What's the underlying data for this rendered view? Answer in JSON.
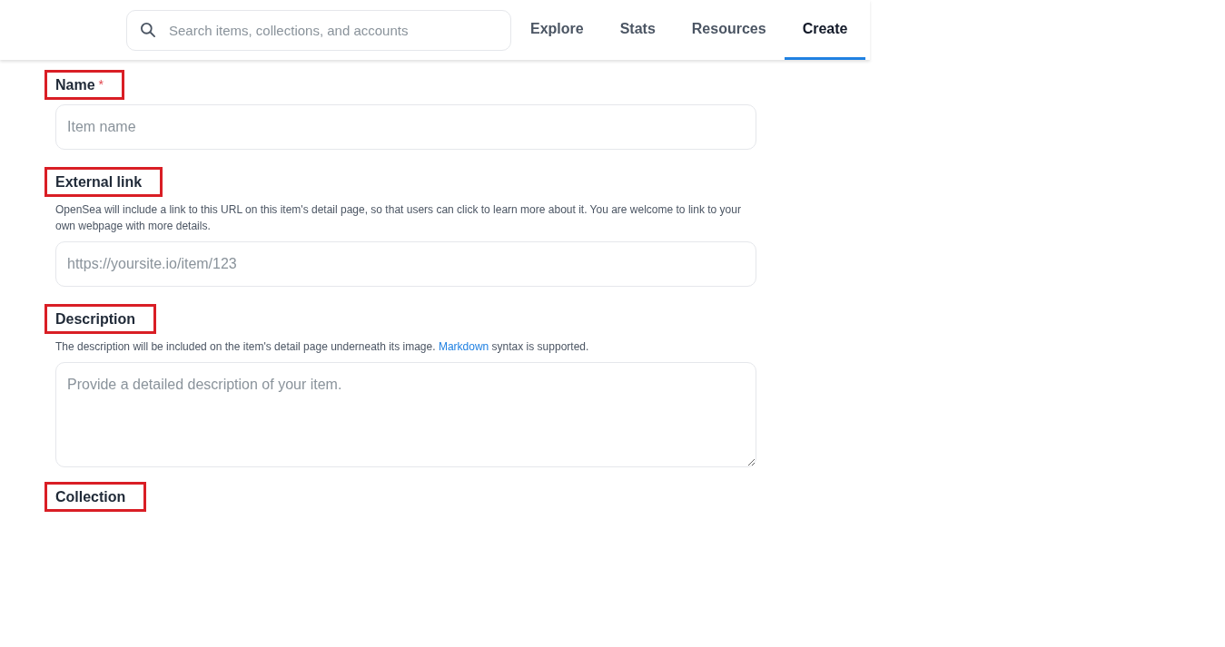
{
  "header": {
    "search": {
      "placeholder": "Search items, collections, and accounts"
    },
    "nav": [
      {
        "label": "Explore",
        "selected": false
      },
      {
        "label": "Stats",
        "selected": false
      },
      {
        "label": "Resources",
        "selected": false
      },
      {
        "label": "Create",
        "selected": true
      }
    ]
  },
  "form": {
    "fields": [
      {
        "kind": "input",
        "label": "Name",
        "required_mark": "*",
        "highlighted": true,
        "placeholder": "Item name"
      },
      {
        "kind": "input",
        "label": "External link",
        "highlighted": true,
        "hint": {
          "text": "OpenSea will include a link to this URL on this item's detail page, so that users can click to learn more about it. You are welcome to link to your own webpage with more details."
        },
        "placeholder": "https://yoursite.io/item/123"
      },
      {
        "kind": "textarea",
        "label": "Description",
        "highlighted": true,
        "hint": {
          "text": "The description will be included on the item's detail page underneath its image.",
          "link": "Markdown",
          "after": "syntax is supported."
        },
        "placeholder": "Provide a detailed description of your item."
      },
      {
        "kind": "section",
        "label": "Collection",
        "highlighted": true
      }
    ]
  }
}
